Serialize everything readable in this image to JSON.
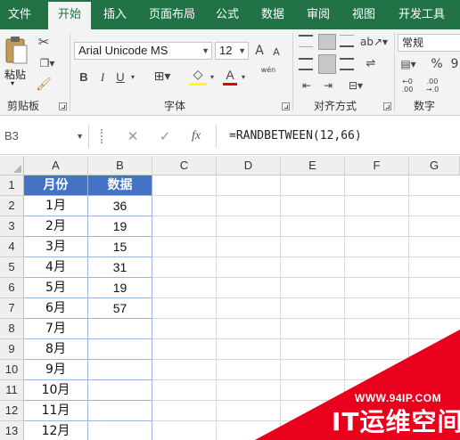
{
  "ribbon_tabs": [
    "文件",
    "开始",
    "插入",
    "页面布局",
    "公式",
    "数据",
    "审阅",
    "视图",
    "开发工具"
  ],
  "clipboard": {
    "paste_label": "粘贴",
    "group_label": "剪贴板"
  },
  "font": {
    "name": "Arial Unicode MS",
    "size": "12",
    "group_label": "字体",
    "bold": "B",
    "italic": "I",
    "underline": "U",
    "phonetic": "wén",
    "grow": "A",
    "shrink": "A",
    "font_color": "A"
  },
  "alignment": {
    "group_label": "对齐方式"
  },
  "number": {
    "format": "常规",
    "group_label": "数字",
    "percent": "%",
    "comma": "9"
  },
  "formula_bar": {
    "name_box": "B3",
    "cancel": "✕",
    "enter": "✓",
    "fx": "fx",
    "formula": "=RANDBETWEEN(12,66)"
  },
  "columns": [
    "A",
    "B",
    "C",
    "D",
    "E",
    "F",
    "G"
  ],
  "rows": [
    "1",
    "2",
    "3",
    "4",
    "5",
    "6",
    "7",
    "8",
    "9",
    "10",
    "11",
    "12",
    "13"
  ],
  "table": {
    "headers": [
      "月份",
      "数据"
    ],
    "months": [
      "1月",
      "2月",
      "3月",
      "4月",
      "5月",
      "6月",
      "7月",
      "8月",
      "9月",
      "10月",
      "11月",
      "12月"
    ],
    "values": [
      "36",
      "19",
      "15",
      "31",
      "19",
      "57",
      "",
      "",
      "",
      "",
      "",
      ""
    ]
  },
  "watermark": {
    "url": "WWW.94IP.COM",
    "brand": "IT运维空间"
  },
  "colors": {
    "accent": "#217346",
    "table_header": "#4472c4",
    "watermark": "#e8001c"
  }
}
